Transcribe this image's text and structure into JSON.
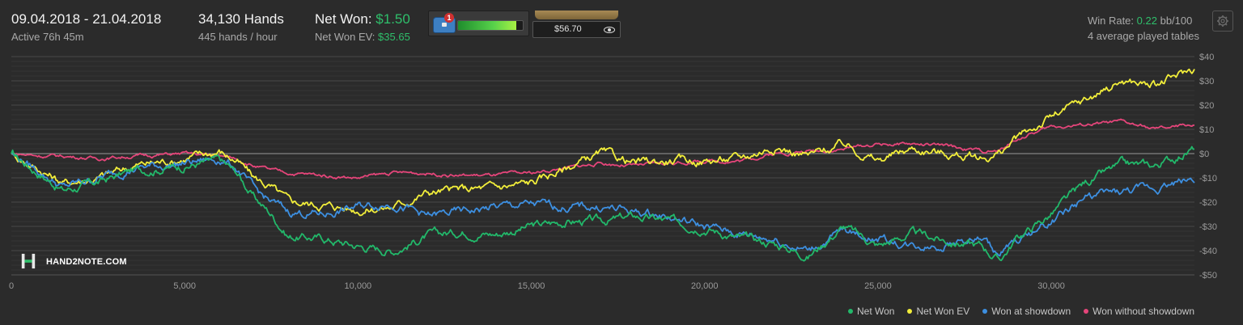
{
  "header": {
    "date_range": "09.04.2018 - 21.04.2018",
    "active_time": "Active 76h 45m",
    "hands": "34,130 Hands",
    "hands_rate": "445 hands / hour",
    "net_won_label": "Net Won:",
    "net_won_value": "$1.50",
    "net_won_ev_label": "Net Won  EV:",
    "net_won_ev_value": "$35.65",
    "notification_count": "1",
    "level_progress": 0.9,
    "balance": "$56.70",
    "win_rate_label": "Win Rate:",
    "win_rate_value": "0.22",
    "win_rate_unit": "bb/100",
    "tables_info": "4 average played tables"
  },
  "brand": {
    "logo_text": "HAND2NOTE.COM"
  },
  "colors": {
    "background": "#2b2b2b",
    "net_won": "#22b86a",
    "net_won_ev": "#f2ee3a",
    "won_at_showdown": "#3d8fe0",
    "won_without_showdown": "#e5457a"
  },
  "chart_data": {
    "type": "line",
    "x_ticks": [
      0,
      5000,
      10000,
      15000,
      20000,
      25000,
      30000
    ],
    "x_tick_labels": [
      "0",
      "5,000",
      "10,000",
      "15,000",
      "20,000",
      "25,000",
      "30,000"
    ],
    "y_ticks": [
      40,
      30,
      20,
      10,
      0,
      -10,
      -20,
      -30,
      -40,
      -50
    ],
    "y_tick_labels": [
      "$40",
      "$30",
      "$20",
      "$10",
      "$0",
      "-$10",
      "-$20",
      "-$30",
      "-$40",
      "-$50"
    ],
    "xlim": [
      0,
      34130
    ],
    "ylim": [
      -50,
      40
    ],
    "grid": true,
    "legend_position": "bottom-right",
    "x": [
      0,
      1000,
      1500,
      2500,
      3500,
      5000,
      6000,
      6500,
      7000,
      7500,
      8000,
      9000,
      10000,
      11000,
      12000,
      13000,
      14000,
      15000,
      16000,
      17000,
      18000,
      19000,
      20000,
      21000,
      22000,
      23000,
      24000,
      25000,
      26000,
      27000,
      28000,
      28500,
      29000,
      30000,
      31000,
      32000,
      33000,
      34130
    ],
    "series": [
      {
        "name": "Net Won",
        "values": [
          0,
          -10,
          -15,
          -12,
          -7,
          -5,
          -3,
          -8,
          -18,
          -25,
          -34,
          -35,
          -38,
          -40,
          -34,
          -32,
          -33,
          -30,
          -28,
          -28,
          -26,
          -28,
          -30,
          -35,
          -37,
          -42,
          -30,
          -38,
          -33,
          -36,
          -38,
          -44,
          -35,
          -25,
          -12,
          -5,
          -5,
          2
        ]
      },
      {
        "name": "Net Won  EV",
        "values": [
          0,
          -8,
          -12,
          -10,
          -5,
          -2,
          1,
          -3,
          -10,
          -14,
          -20,
          -21,
          -23,
          -22,
          -16,
          -15,
          -14,
          -12,
          -6,
          0,
          -4,
          -3,
          -3,
          -2,
          3,
          -1,
          4,
          -3,
          2,
          0,
          -2,
          0,
          6,
          15,
          22,
          30,
          28,
          35
        ]
      },
      {
        "name": "Won at showdown",
        "values": [
          0,
          -9,
          -14,
          -10,
          -6,
          -4,
          -2,
          -6,
          -15,
          -20,
          -24,
          -25,
          -22,
          -20,
          -26,
          -24,
          -22,
          -21,
          -22,
          -22,
          -24,
          -26,
          -30,
          -33,
          -35,
          -40,
          -32,
          -35,
          -38,
          -37,
          -35,
          -42,
          -36,
          -28,
          -18,
          -16,
          -14,
          -10
        ]
      },
      {
        "name": "Won without showdown",
        "values": [
          0,
          -1,
          -1,
          -2,
          -1,
          0,
          -1,
          -2,
          -5,
          -7,
          -8,
          -9,
          -10,
          -8,
          -8,
          -9,
          -9,
          -8,
          -6,
          -4,
          -5,
          -4,
          -3,
          -3,
          0,
          1,
          2,
          4,
          4,
          3,
          1,
          1,
          6,
          11,
          12,
          13,
          10,
          12
        ]
      }
    ]
  }
}
